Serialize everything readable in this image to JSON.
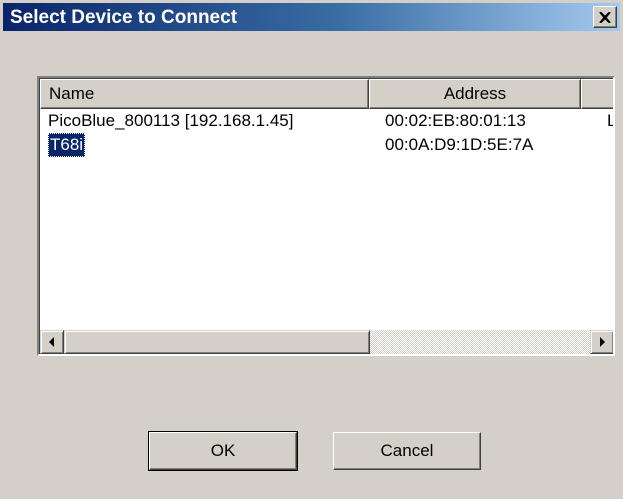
{
  "window": {
    "title": "Select Device to Connect",
    "close_icon": "close-icon"
  },
  "list": {
    "columns": [
      "Name",
      "Address",
      ""
    ],
    "rows": [
      {
        "name": "PicoBlue_800113 [192.168.1.45]",
        "address": "00:02:EB:80:01:13",
        "extra": "L",
        "selected": false
      },
      {
        "name": "T68i",
        "address": "00:0A:D9:1D:5E:7A",
        "extra": "",
        "selected": true
      }
    ],
    "scrollbar_icons": [
      "arrow-left-icon",
      "arrow-right-icon"
    ]
  },
  "buttons": {
    "ok_label": "OK",
    "cancel_label": "Cancel"
  },
  "colors": {
    "title_gradient_start": "#0a246a",
    "title_gradient_end": "#a6caf0",
    "selection": "#0a246a",
    "face": "#d4d0c8"
  }
}
